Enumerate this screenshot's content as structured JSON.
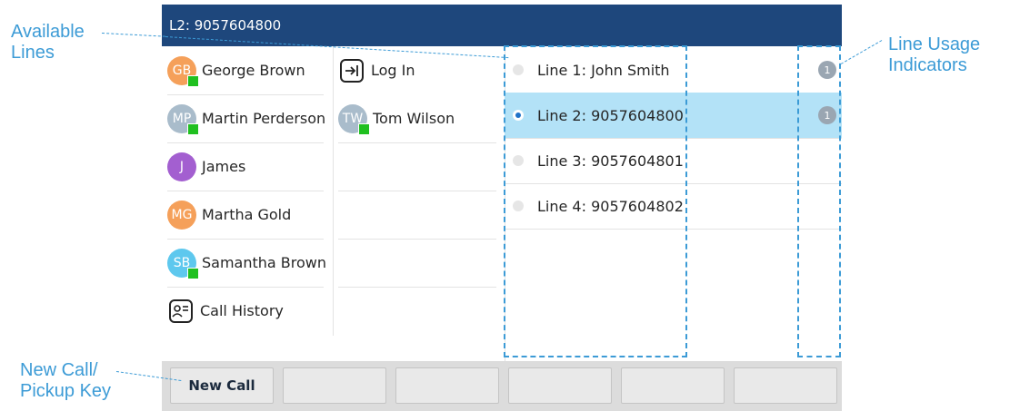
{
  "callouts": {
    "available_lines": "Available\nLines",
    "line_usage": "Line Usage\nIndicators",
    "new_call_pickup": "New Call/\nPickup Key"
  },
  "header": {
    "title": "L2: 9057604800"
  },
  "contacts_col1": [
    {
      "initials": "GB",
      "name": "George Brown",
      "color": "#f5a05a",
      "presence": true
    },
    {
      "initials": "MP",
      "name": "Martin Perderson",
      "color": "#a9bccb",
      "presence": true
    },
    {
      "initials": "J",
      "name": "James",
      "color": "#a35fd0",
      "presence": false
    },
    {
      "initials": "MG",
      "name": "Martha Gold",
      "color": "#f5a05a",
      "presence": false
    },
    {
      "initials": "SB",
      "name": "Samantha Brown",
      "color": "#5ec8ee",
      "presence": true
    }
  ],
  "call_history": {
    "label": "Call History",
    "icon": "call-history-icon"
  },
  "login": {
    "label": "Log In",
    "icon": "login-icon"
  },
  "contacts_col2": [
    {
      "initials": "TW",
      "name": "Tom Wilson",
      "color": "#a9bccb",
      "presence": true
    }
  ],
  "lines": [
    {
      "label": "Line 1: John Smith",
      "selected": false,
      "usage": "1"
    },
    {
      "label": "Line 2: 9057604800",
      "selected": true,
      "usage": "1"
    },
    {
      "label": "Line 3: 9057604801",
      "selected": false,
      "usage": ""
    },
    {
      "label": "Line 4: 9057604802",
      "selected": false,
      "usage": ""
    }
  ],
  "softkeys": [
    "New Call",
    "",
    "",
    "",
    "",
    ""
  ],
  "colors": {
    "header": "#1e477c",
    "selected_row": "#b3e2f7",
    "callout": "#3c9bd6",
    "presence": "#20c020"
  }
}
